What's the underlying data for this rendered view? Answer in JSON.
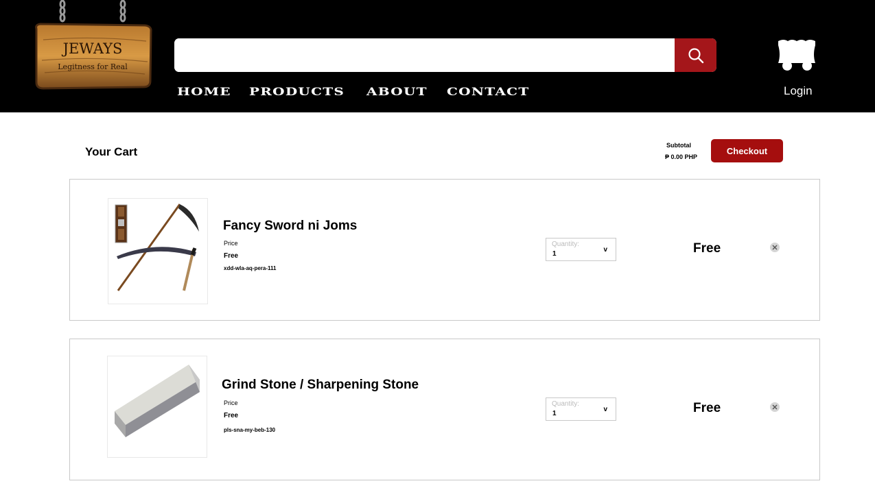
{
  "header": {
    "logo": {
      "title": "JEWAYS",
      "tagline": "Legitness for Real"
    },
    "search": {
      "placeholder": "",
      "value": ""
    },
    "nav": [
      {
        "label": "HOME"
      },
      {
        "label": "PRODUCTS"
      },
      {
        "label": "ABOUT"
      },
      {
        "label": "CONTACT"
      }
    ],
    "cart_icon": "cart-wagon-icon",
    "login_label": "Login"
  },
  "cart": {
    "title": "Your Cart",
    "subtotal_label": "Subtotal",
    "subtotal_value": "₱ 0.00 PHP",
    "checkout_label": "Checkout",
    "items": [
      {
        "name": "Fancy Sword ni Joms",
        "price_label": "Price",
        "price": "Free",
        "sku": "xdd-wla-aq-pera-111",
        "quantity_label": "Quantity:",
        "quantity": "1",
        "chevron": "v",
        "total": "Free",
        "image_icon": "scythe-image"
      },
      {
        "name": "Grind Stone / Sharpening Stone",
        "price_label": "Price",
        "price": "Free",
        "sku": "pls-sna-my-beb-130",
        "quantity_label": "Quantity:",
        "quantity": "1",
        "chevron": "v",
        "total": "Free",
        "image_icon": "sharpening-stone-image"
      }
    ]
  },
  "colors": {
    "header_bg": "#000000",
    "accent": "#a50e0e",
    "search_button": "#a4161a"
  }
}
